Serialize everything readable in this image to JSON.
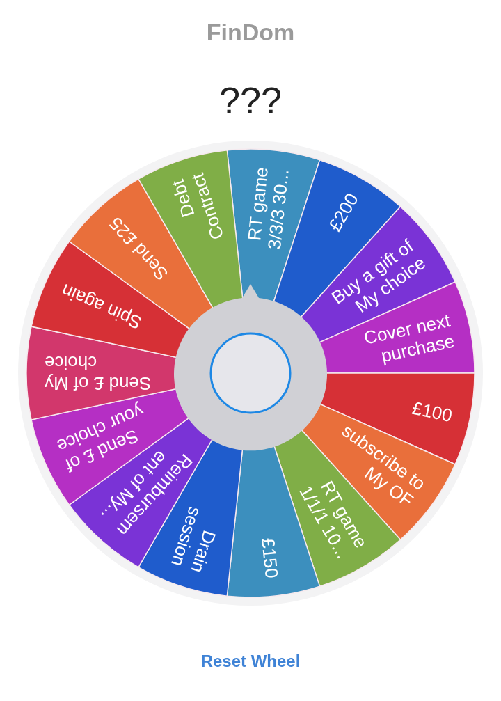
{
  "title": "FinDom",
  "result": "???",
  "segments": [
    {
      "lines": [
        "RT game",
        "3/3/3 30..."
      ],
      "color": "#3c8fbe"
    },
    {
      "lines": [
        "£200"
      ],
      "color": "#1f5ccc"
    },
    {
      "lines": [
        "Buy a gift of",
        "My choice"
      ],
      "color": "#7a33d6"
    },
    {
      "lines": [
        "Cover next",
        "purchase"
      ],
      "color": "#b52fc4"
    },
    {
      "lines": [
        "£100"
      ],
      "color": "#d63036"
    },
    {
      "lines": [
        "subscribe to",
        "My OF"
      ],
      "color": "#e96f3b"
    },
    {
      "lines": [
        "RT game",
        "1/1/1 10..."
      ],
      "color": "#80ae47"
    },
    {
      "lines": [
        "£150"
      ],
      "color": "#3c8fbe"
    },
    {
      "lines": [
        "Drain",
        "session"
      ],
      "color": "#1f5ccc"
    },
    {
      "lines": [
        "Reimbursem",
        "ent of My..."
      ],
      "color": "#7a33d6"
    },
    {
      "lines": [
        "Send £ of",
        "your choice"
      ],
      "color": "#b52fc4"
    },
    {
      "lines": [
        "Send £ of My",
        "choice"
      ],
      "color": "#d2376c"
    },
    {
      "lines": [
        "Spin again"
      ],
      "color": "#d63036"
    },
    {
      "lines": [
        "Send £25"
      ],
      "color": "#e96f3b"
    },
    {
      "lines": [
        "Debt",
        "Contract"
      ],
      "color": "#80ae47"
    }
  ],
  "reset_button": "Reset Wheel"
}
